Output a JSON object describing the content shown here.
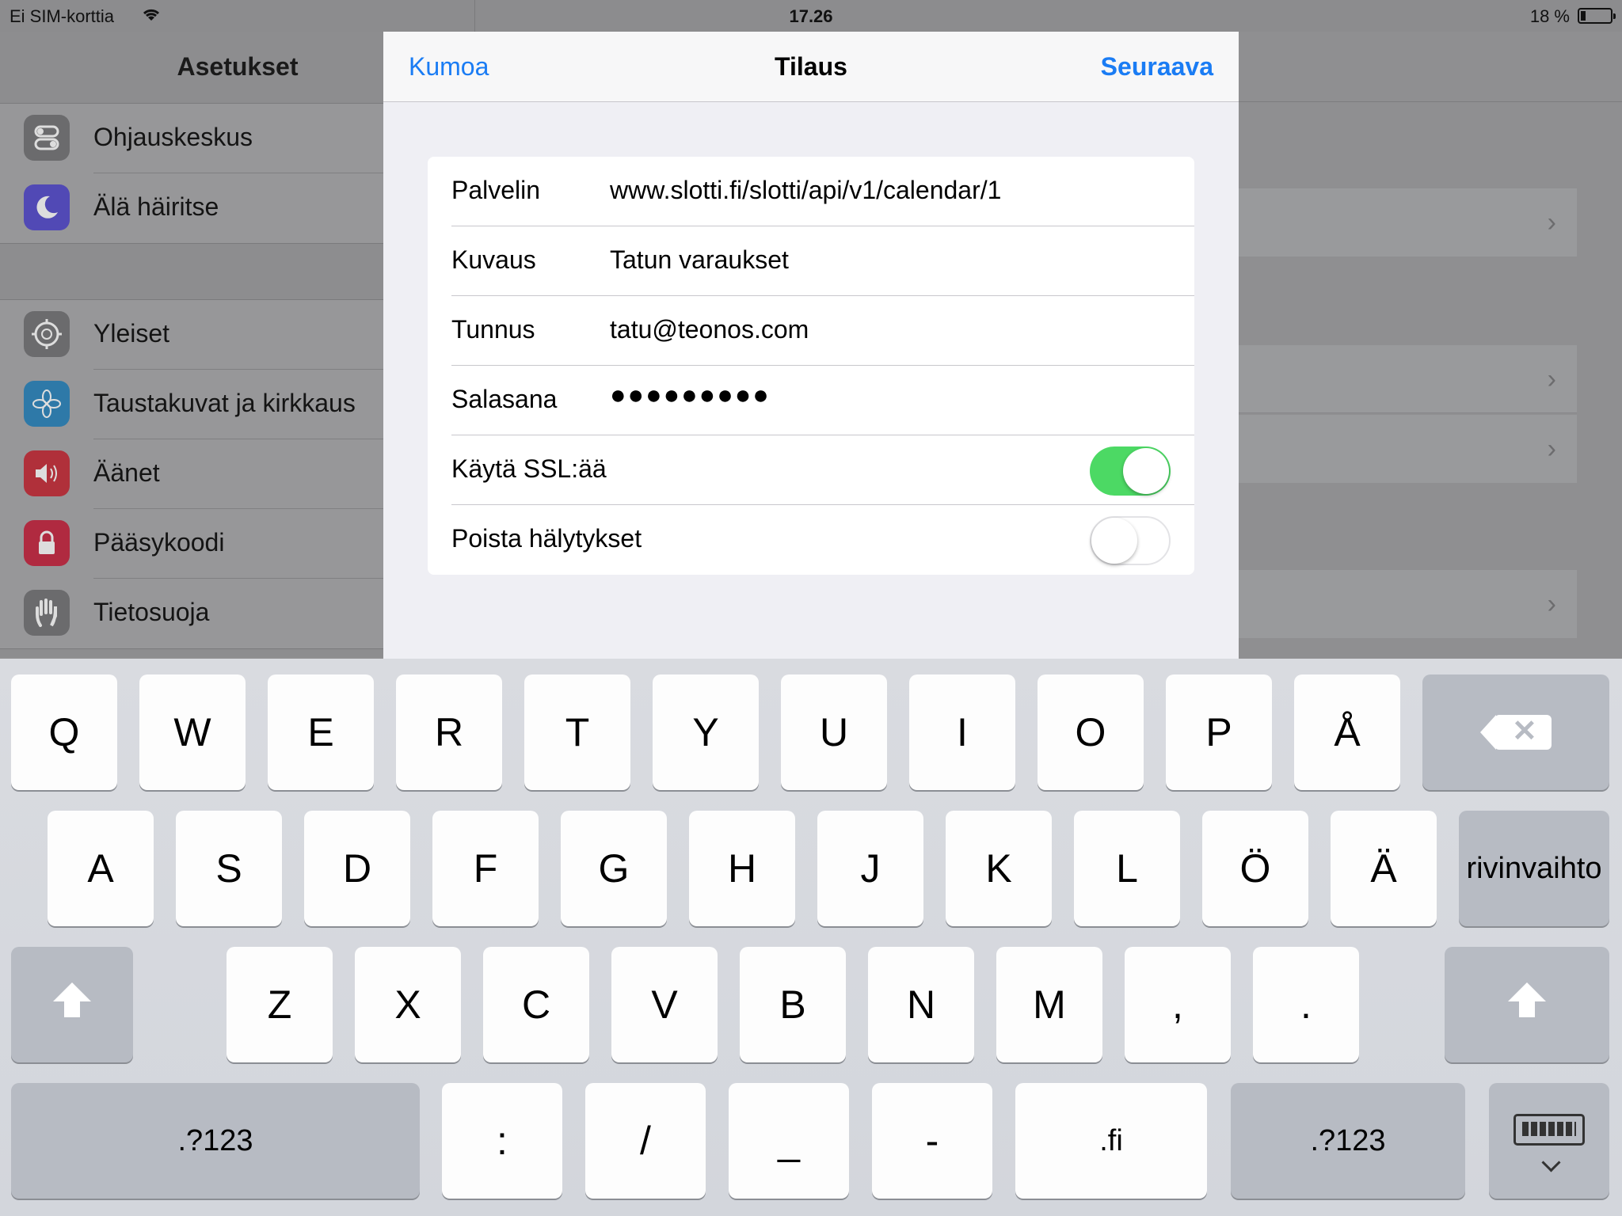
{
  "status_bar": {
    "carrier": "Ei SIM-korttia",
    "time": "17.26",
    "battery": "18 %"
  },
  "sidebar": {
    "title": "Asetukset",
    "group1": [
      {
        "label": "Ohjauskeskus",
        "icon": "control-center-icon",
        "color": "#6b6b6d"
      },
      {
        "label": "Älä häiritse",
        "icon": "moon-icon",
        "color": "#5149b5"
      }
    ],
    "group2": [
      {
        "label": "Yleiset",
        "icon": "gear-icon",
        "color": "#6b6b6d"
      },
      {
        "label": "Taustakuvat ja kirkkaus",
        "icon": "flower-icon",
        "color": "#2e79a8"
      },
      {
        "label": "Äänet",
        "icon": "speaker-icon",
        "color": "#b0303a"
      },
      {
        "label": "Pääsykoodi",
        "icon": "lock-icon",
        "color": "#b02a40"
      },
      {
        "label": "Tietosuoja",
        "icon": "hand-icon",
        "color": "#6b6b6d"
      }
    ]
  },
  "modal": {
    "cancel": "Kumoa",
    "title": "Tilaus",
    "next": "Seuraava",
    "fields": {
      "server": {
        "label": "Palvelin",
        "value": "www.slotti.fi/slotti/api/v1/calendar/1"
      },
      "description": {
        "label": "Kuvaus",
        "value": "Tatun varaukset"
      },
      "username": {
        "label": "Tunnus",
        "value": "tatu@teonos.com"
      },
      "password": {
        "label": "Salasana",
        "value": "●●●●●●●●●"
      },
      "ssl": {
        "label": "Käytä SSL:ää",
        "on": true
      },
      "remove_alerts": {
        "label": "Poista hälytykset",
        "on": false
      }
    }
  },
  "keyboard": {
    "row1": [
      "Q",
      "W",
      "E",
      "R",
      "T",
      "Y",
      "U",
      "I",
      "O",
      "P",
      "Å"
    ],
    "row2": [
      "A",
      "S",
      "D",
      "F",
      "G",
      "H",
      "J",
      "K",
      "L",
      "Ö",
      "Ä"
    ],
    "return": "rivinvaihto",
    "row3": [
      "Z",
      "X",
      "C",
      "V",
      "B",
      "N",
      "M",
      ",",
      "."
    ],
    "numbers_left": ".?123",
    "row4": [
      ":",
      "/",
      "_",
      "-",
      ".fi"
    ],
    "numbers_right": ".?123"
  },
  "colors": {
    "accent": "#1a7cf4",
    "toggle_on": "#4cd964"
  }
}
